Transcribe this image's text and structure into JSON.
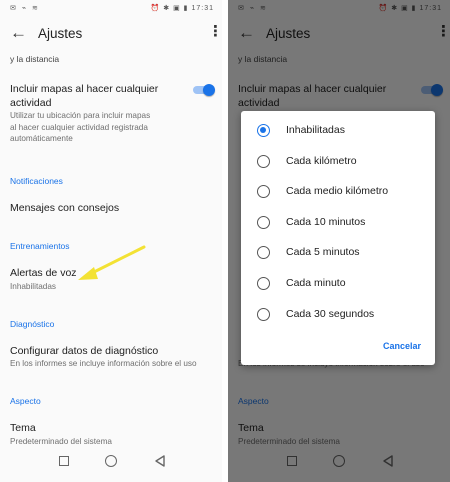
{
  "status": {
    "left_icons": "✉ ⌁ ≋",
    "right_icons": "⏰ ✱ ▣ ▮",
    "time": "17:31"
  },
  "appbar": {
    "title": "Ajustes",
    "back_icon": "←",
    "more_icon": "⋮"
  },
  "settings": {
    "partial_text": "y la distancia",
    "maps": {
      "title_line1": "Incluir mapas al hacer cualquier",
      "title_line2": "actividad",
      "desc_line1": "Utilizar tu ubicación para incluir mapas",
      "desc_line2": "al hacer cualquier actividad registrada",
      "desc_line3": "automáticamente",
      "toggle_on": true
    },
    "notifications_header": "Notificaciones",
    "tips": "Mensajes con consejos",
    "training_header": "Entrenamientos",
    "voice_alerts": {
      "title": "Alertas de voz",
      "value": "Inhabilitadas"
    },
    "diagnostics_header": "Diagnóstico",
    "diagnostics": {
      "title": "Configurar datos de diagnóstico",
      "desc": "En los informes se incluye información sobre el uso"
    },
    "appearance_header": "Aspecto",
    "theme": {
      "title": "Tema",
      "value": "Predeterminado del sistema"
    }
  },
  "dialog": {
    "options": [
      "Inhabilitadas",
      "Cada kilómetro",
      "Cada medio kilómetro",
      "Cada 10 minutos",
      "Cada 5 minutos",
      "Cada minuto",
      "Cada 30 segundos"
    ],
    "selected_index": 0,
    "cancel_label": "Cancelar"
  },
  "colors": {
    "accent": "#1a73e8",
    "arrow": "#f3e234"
  }
}
